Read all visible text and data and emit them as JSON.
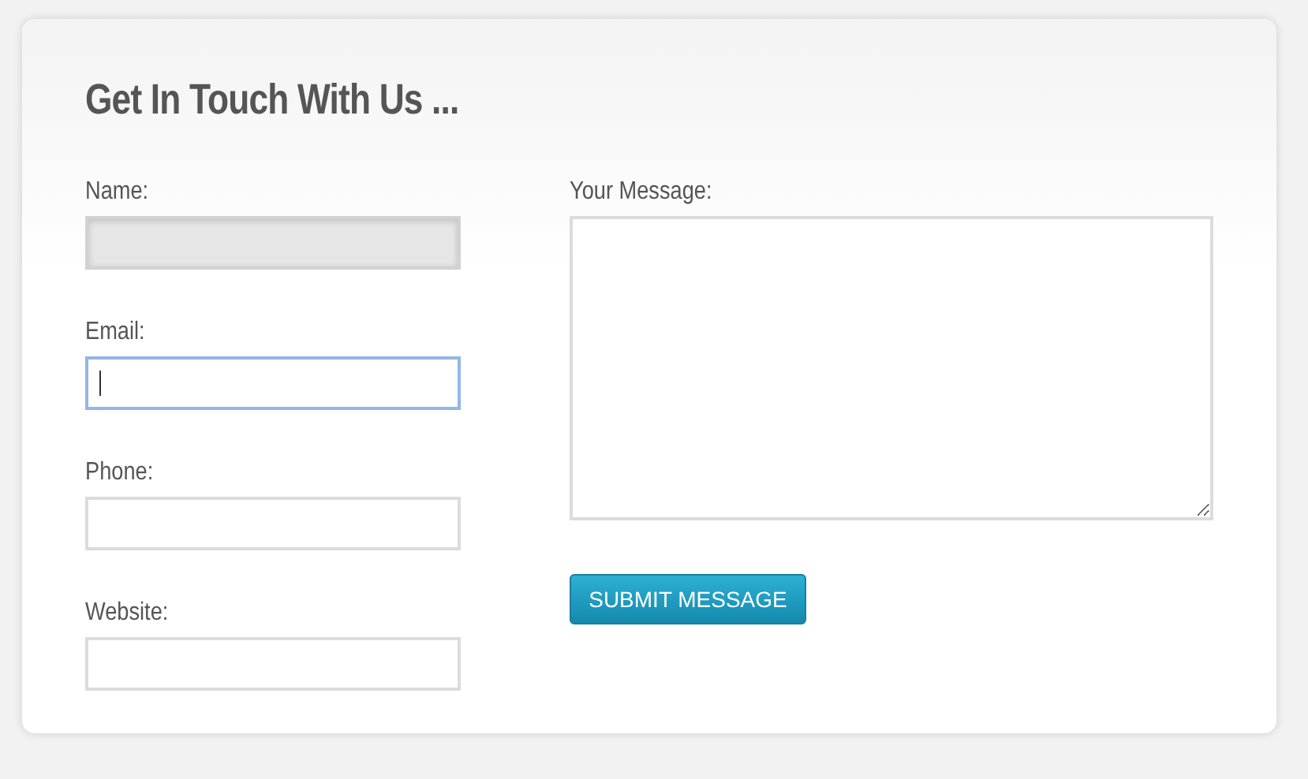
{
  "form": {
    "title": "Get In Touch With Us ...",
    "fields": [
      {
        "label": "Name:",
        "focused": false,
        "highlighted": true
      },
      {
        "label": "Email:",
        "focused": true,
        "highlighted": false
      },
      {
        "label": "Phone:",
        "focused": false,
        "highlighted": false
      },
      {
        "label": "Website:",
        "focused": false,
        "highlighted": false
      }
    ],
    "message": {
      "label": "Your Message:"
    },
    "submit_button": "SUBMIT MESSAGE"
  }
}
